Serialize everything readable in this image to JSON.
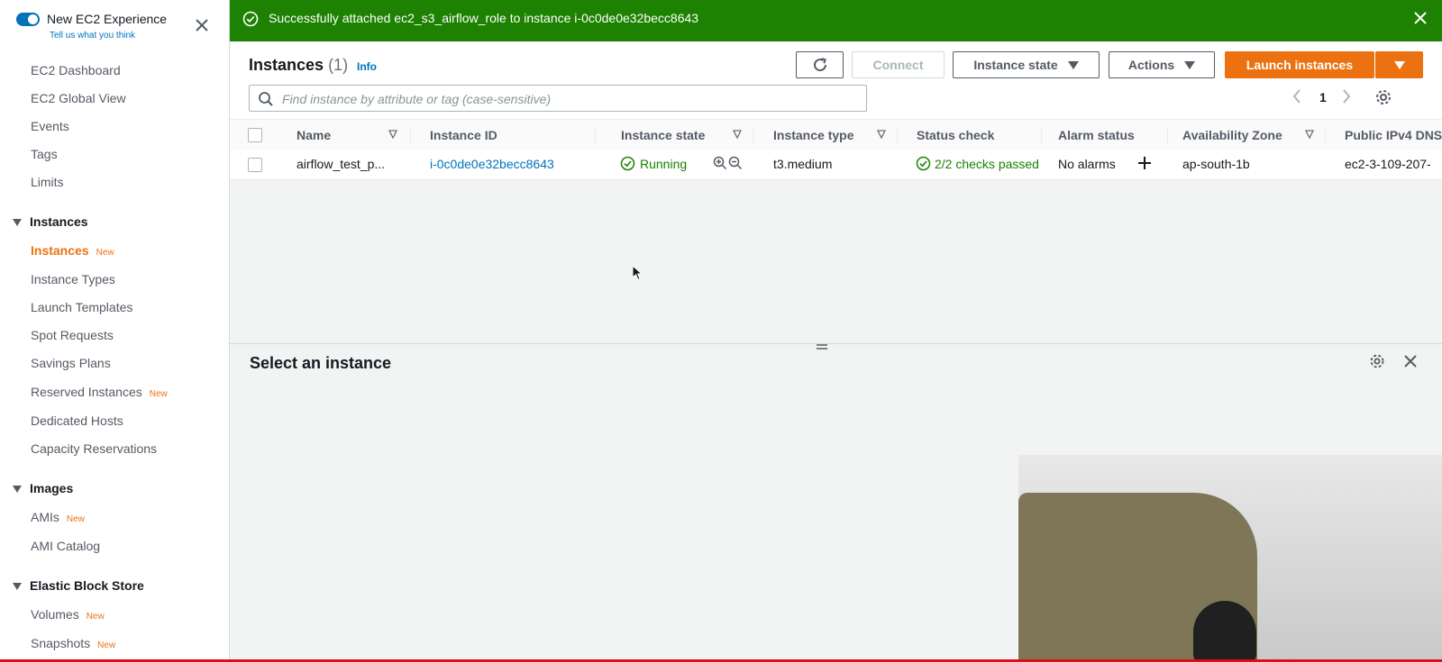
{
  "sidebar": {
    "experience_title": "New EC2 Experience",
    "experience_link": "Tell us what you think",
    "badge_new": "New",
    "items_top": [
      "EC2 Dashboard",
      "EC2 Global View",
      "Events",
      "Tags",
      "Limits"
    ],
    "section_instances": "Instances",
    "instances_items": [
      "Instances",
      "Instance Types",
      "Launch Templates",
      "Spot Requests",
      "Savings Plans",
      "Reserved Instances",
      "Dedicated Hosts",
      "Capacity Reservations"
    ],
    "section_images": "Images",
    "images_items": [
      "AMIs",
      "AMI Catalog"
    ],
    "section_ebs": "Elastic Block Store",
    "ebs_items": [
      "Volumes",
      "Snapshots"
    ]
  },
  "flash": {
    "message": "Successfully attached ec2_s3_airflow_role to instance i-0c0de0e32becc8643",
    "color": "#1d8102"
  },
  "panel": {
    "title": "Instances",
    "count": "(1)",
    "info": "Info",
    "connect": "Connect",
    "instance_state": "Instance state",
    "actions": "Actions",
    "launch": "Launch instances",
    "search_placeholder": "Find instance by attribute or tag (case-sensitive)",
    "page": "1"
  },
  "table": {
    "columns": [
      "Name",
      "Instance ID",
      "Instance state",
      "Instance type",
      "Status check",
      "Alarm status",
      "Availability Zone",
      "Public IPv4 DNS"
    ],
    "rows": [
      {
        "name": "airflow_test_p...",
        "instance_id": "i-0c0de0e32becc8643",
        "state": "Running",
        "type": "t3.medium",
        "status_check": "2/2 checks passed",
        "alarm": "No alarms",
        "az": "ap-south-1b",
        "dns": "ec2-3-109-207-"
      }
    ]
  },
  "details": {
    "title": "Select an instance"
  },
  "colors": {
    "accent_orange": "#ec7211",
    "link_blue": "#0073bb",
    "success_green": "#1d8102"
  }
}
